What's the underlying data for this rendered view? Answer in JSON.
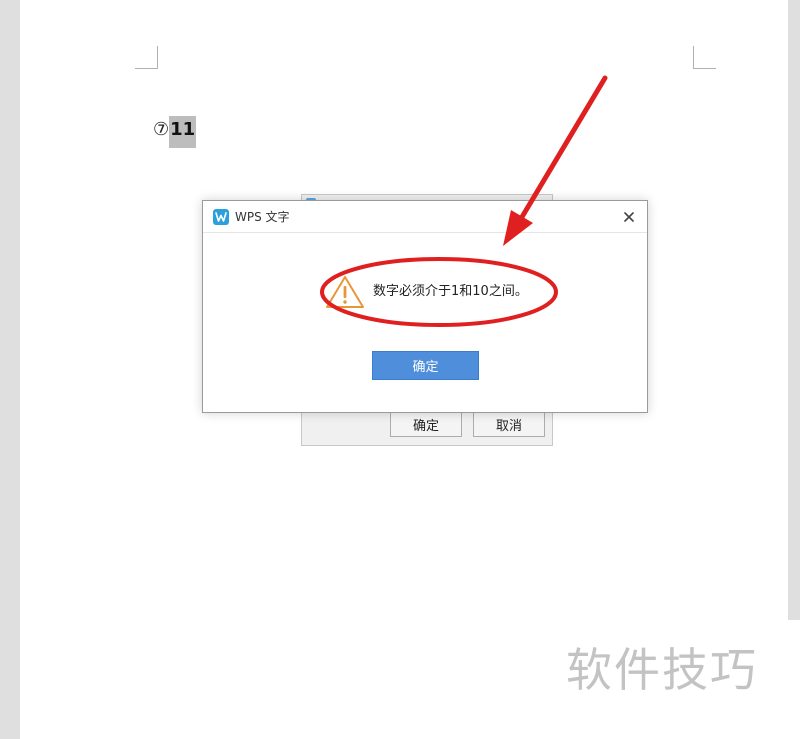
{
  "document": {
    "circled_number": "⑦",
    "selected_text": "11"
  },
  "underlying_dialog": {
    "ok_label": "确定",
    "cancel_label": "取消"
  },
  "message_box": {
    "title": "WPS 文字",
    "message": "数字必须介于1和10之间。",
    "ok_label": "确定",
    "close_icon": "close-icon",
    "warning_icon": "warning-triangle-icon"
  },
  "watermark": {
    "text": "软件技巧"
  },
  "colors": {
    "accent_button": "#4f8edb",
    "annotation_red": "#e02020",
    "warning_orange": "#e8963a",
    "app_logo": "#2ba0dc"
  }
}
